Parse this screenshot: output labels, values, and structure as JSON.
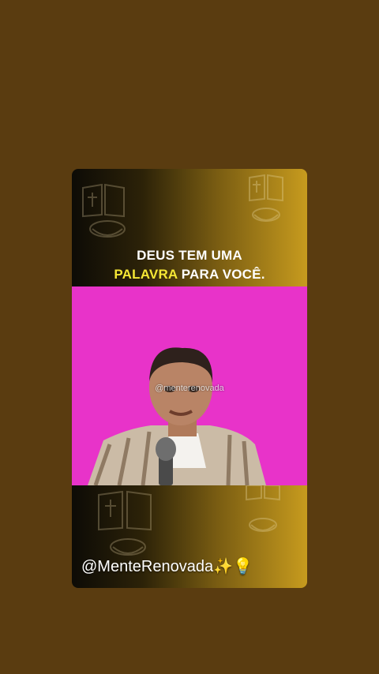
{
  "headline": {
    "line1": "DEUS TEM UMA",
    "highlight": "PALAVRA",
    "line2_rest": "PARA VOCÊ."
  },
  "video": {
    "watermark": "@menterenovada"
  },
  "footer": {
    "handle": "@MenteRenovada✨💡"
  },
  "colors": {
    "page_bg": "#5a3c10",
    "video_bg": "#e833c9",
    "highlight": "#f5e735",
    "gold": "#c79b1e"
  },
  "icons": [
    "bible-icon",
    "bread-basket-icon",
    "sparkles-icon",
    "lightbulb-icon"
  ]
}
